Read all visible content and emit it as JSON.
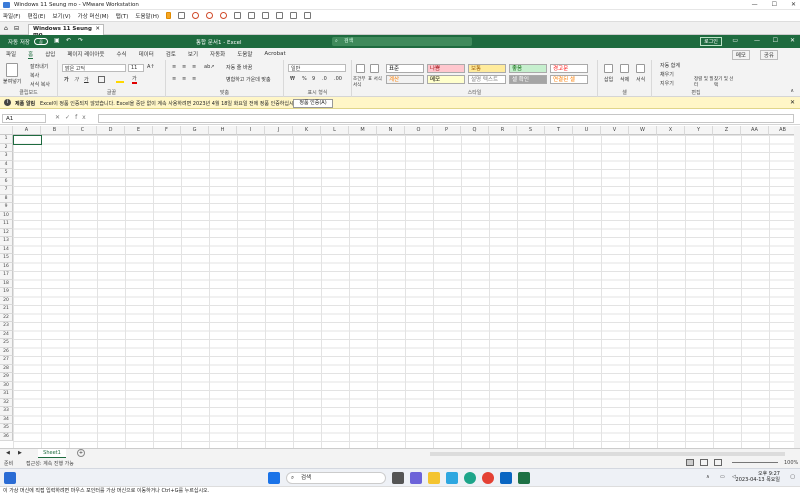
{
  "vm": {
    "title": "Windows 11 Seung mo - VMware Workstation",
    "menu": [
      "파일(F)",
      "편집(E)",
      "보기(V)",
      "가상 머신(M)",
      "탭(T)",
      "도움말(H)"
    ],
    "tab_label": "Windows 11 Seung mo",
    "status_text": "이 가상 머신에 직접 입력하려면 마우스 포인터를 가상 머신으로 이동하거나 Ctrl+G를 누르십시오."
  },
  "excel": {
    "autosave": "자동 저장",
    "autosave_state": "끔",
    "doc_title": "통합 문서1 - Excel",
    "search_placeholder": "검색",
    "signin": "로그인",
    "tabs": [
      "파일",
      "홈",
      "삽입",
      "페이지 레이아웃",
      "수식",
      "데이터",
      "검토",
      "보기",
      "자동화",
      "도움말",
      "Acrobat"
    ],
    "active_tab": "홈",
    "share": "메모",
    "share2": "공유"
  },
  "ribbon": {
    "clipboard": {
      "paste": "붙여넣기",
      "cut": "잘라내기",
      "copy": "복사",
      "format_painter": "서식 복사",
      "label": "클립보드"
    },
    "font": {
      "name": "맑은 고딕",
      "size": "11",
      "label": "글꼴"
    },
    "align": {
      "wrap": "자동 줄 바꿈",
      "merge": "병합하고 가운데 맞춤",
      "label": "맞춤"
    },
    "number": {
      "format": "일반",
      "label": "표시 형식"
    },
    "styles": {
      "cond": "조건부 서식",
      "table": "표 서식",
      "items": [
        {
          "label": "표준",
          "bg": "#ffffff",
          "fg": "#000000"
        },
        {
          "label": "나쁨",
          "bg": "#ffc7ce",
          "fg": "#9c0006"
        },
        {
          "label": "보통",
          "bg": "#ffeb9c",
          "fg": "#9c5700"
        },
        {
          "label": "좋음",
          "bg": "#c6efce",
          "fg": "#006100"
        },
        {
          "label": "경고문",
          "bg": "#ffffff",
          "fg": "#ff0000"
        },
        {
          "label": "계산",
          "bg": "#f2f2f2",
          "fg": "#fa7d00"
        },
        {
          "label": "메모",
          "bg": "#ffffcc",
          "fg": "#000000"
        },
        {
          "label": "설명 텍스트",
          "bg": "#ffffff",
          "fg": "#7f7f7f"
        },
        {
          "label": "셀 확인",
          "bg": "#a5a5a5",
          "fg": "#ffffff"
        },
        {
          "label": "연결된 셀",
          "bg": "#ffffff",
          "fg": "#fa7d00"
        }
      ],
      "label": "스타일"
    },
    "cells": {
      "insert": "삽입",
      "delete": "삭제",
      "format": "서식",
      "label": "셀"
    },
    "editing": {
      "autosum": "자동 합계",
      "fill": "채우기",
      "clear": "지우기",
      "sort": "정렬 및 필터",
      "find": "찾기 및 선택",
      "label": "편집"
    }
  },
  "notice": {
    "title": "제품 알림",
    "text": "Excel이 정품 인증되지 않았습니다. Excel을 중단 없이 계속 사용하려면 2023년 4월 18일 화요일 전에 정품 인증하십시오.",
    "button": "정품 인증(A)"
  },
  "formula": {
    "namebox": "A1",
    "fx": "fx",
    "value": ""
  },
  "grid": {
    "columns": [
      "A",
      "B",
      "C",
      "D",
      "E",
      "F",
      "G",
      "H",
      "I",
      "J",
      "K",
      "L",
      "M",
      "N",
      "O",
      "P",
      "Q",
      "R",
      "S",
      "T",
      "U",
      "V",
      "W",
      "X",
      "Y",
      "Z",
      "AA",
      "AB"
    ],
    "rows": [
      "1",
      "2",
      "3",
      "4",
      "5",
      "6",
      "7",
      "8",
      "9",
      "10",
      "11",
      "12",
      "13",
      "14",
      "15",
      "16",
      "17",
      "18",
      "19",
      "20",
      "21",
      "22",
      "23",
      "24",
      "25",
      "26",
      "27",
      "28",
      "29",
      "30",
      "31",
      "32",
      "33",
      "34",
      "35",
      "36"
    ]
  },
  "sheet": {
    "tab": "Sheet1"
  },
  "status": {
    "ready": "준비",
    "accessibility": "접근성: 계속 진행 가능",
    "zoom": "100%"
  },
  "taskbar": {
    "search": "검색",
    "time": "오후 9:27",
    "date": "2023-04-13 목요일"
  }
}
